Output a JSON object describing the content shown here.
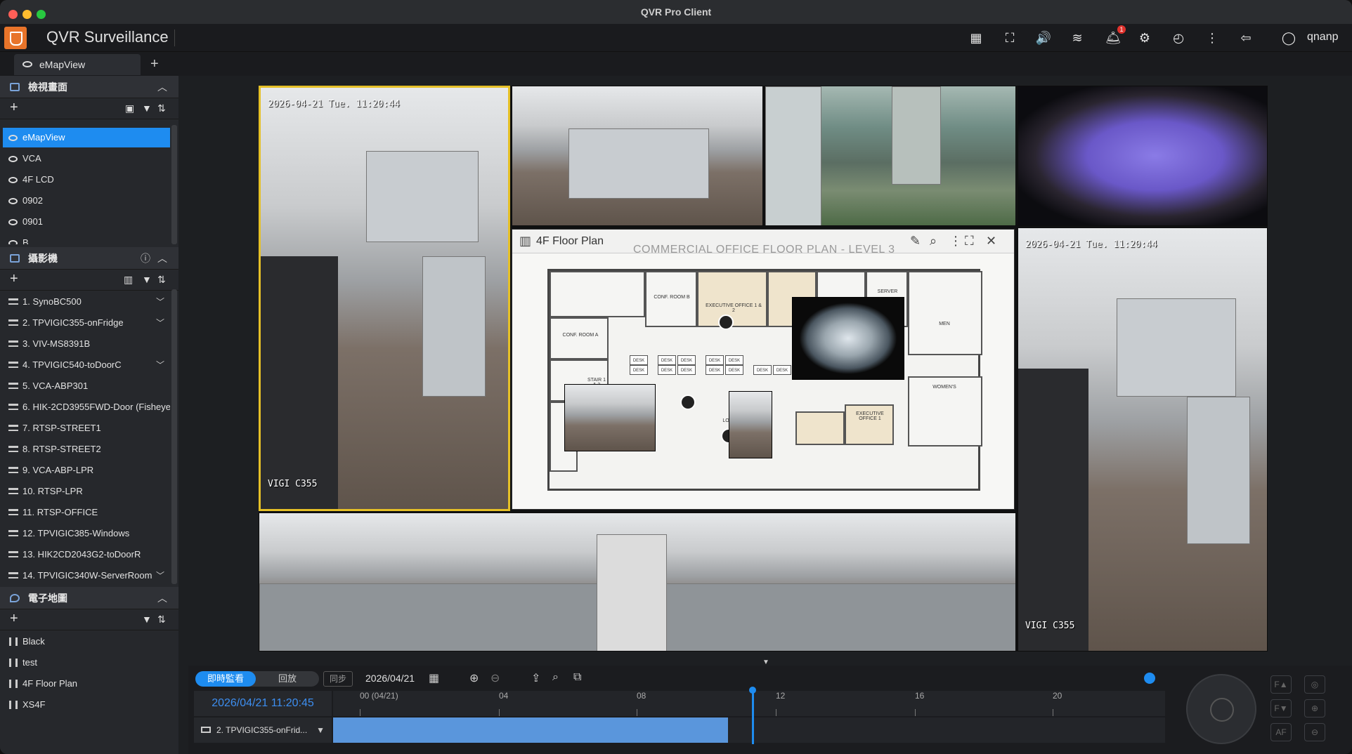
{
  "window": {
    "title": "QVR Pro Client"
  },
  "app": {
    "title": "QVR Surveillance",
    "username": "qnanp",
    "alert_count": "1"
  },
  "tabs": [
    {
      "label": "eMapView"
    }
  ],
  "views": {
    "header": "檢視畫面",
    "items": [
      "eMapView",
      "VCA",
      "4F LCD",
      "0902",
      "0901",
      "B"
    ]
  },
  "cameras": {
    "header": "攝影機",
    "items": [
      "1. SynoBC500",
      "2. TPVIGIC355-onFridge",
      "3. VIV-MS8391B",
      "4. TPVIGIC540-toDoorC",
      "5. VCA-ABP301",
      "6. HIK-2CD3955FWD-Door (Fisheye)",
      "7. RTSP-STREET1",
      "8. RTSP-STREET2",
      "9. VCA-ABP-LPR",
      "10. RTSP-LPR",
      "11. RTSP-OFFICE",
      "12. TPVIGIC385-Windows",
      "13. HIK2CD2043G2-toDoorR",
      "14. TPVIGIC340W-ServerRoom"
    ]
  },
  "emap": {
    "header": "電子地圖",
    "items": [
      "Black",
      "test",
      "4F Floor Plan",
      "XS4F"
    ]
  },
  "grid": {
    "osd_time_1": "2026-04-21 Tue. 11:20:44",
    "osd_time_2": "2026-04-21 Tue. 11:20:44",
    "osd_brand_1": "VIGI C355",
    "osd_brand_2": "VIGI C355"
  },
  "floorplan": {
    "title": "4F Floor Plan",
    "subtitle": "COMMERCIAL OFFICE FLOOR PLAN - LEVEL 3",
    "rooms": {
      "conf_b": "CONF. ROOM B",
      "conf_a": "CONF. ROOM A",
      "exec12": "EXECUTIVE OFFICE 1 & 2",
      "exec1": "EXECUTIVE OFFICE 1",
      "server": "SERVER",
      "men": "MEN",
      "women": "WOMEN'S",
      "stair": "STAIR 1 & 2",
      "lobby": "LOBBY",
      "desk": "DESK"
    }
  },
  "timeline": {
    "live_label": "即時監看",
    "playback_label": "回放",
    "sync_label": "同步",
    "date": "2026/04/21",
    "current_time": "2026/04/21 11:20:45",
    "ticks": [
      "00 (04/21)",
      "04",
      "08",
      "12",
      "16",
      "20"
    ],
    "camera_row": "2. TPVIGIC355-onFrid...",
    "recorded_fraction": 0.475
  }
}
